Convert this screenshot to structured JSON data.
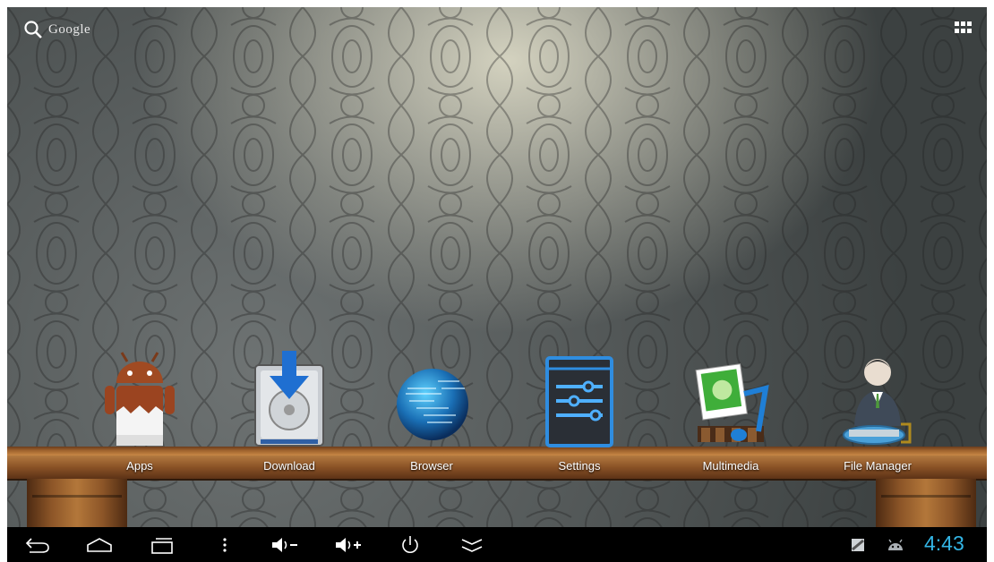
{
  "search": {
    "label": "Google",
    "icon": "search-icon"
  },
  "apps_grid": {
    "icon": "all-apps-icon"
  },
  "dock": [
    {
      "label": "Apps",
      "icon": "android-kitkat-icon"
    },
    {
      "label": "Download",
      "icon": "download-drive-icon"
    },
    {
      "label": "Browser",
      "icon": "globe-icon"
    },
    {
      "label": "Settings",
      "icon": "sliders-icon"
    },
    {
      "label": "Multimedia",
      "icon": "photo-music-icon"
    },
    {
      "label": "File Manager",
      "icon": "businessman-folder-icon"
    }
  ],
  "navbar": {
    "buttons": [
      "back-icon",
      "home-icon",
      "recents-icon",
      "menu-icon",
      "volume-down-icon",
      "volume-up-icon",
      "power-icon",
      "hide-bar-icon"
    ],
    "status_icons": [
      "screenshot-notification-icon",
      "usb-debugging-icon"
    ],
    "clock": "4:43"
  },
  "colors": {
    "clock": "#33b5e5",
    "navbar": "#000000"
  }
}
